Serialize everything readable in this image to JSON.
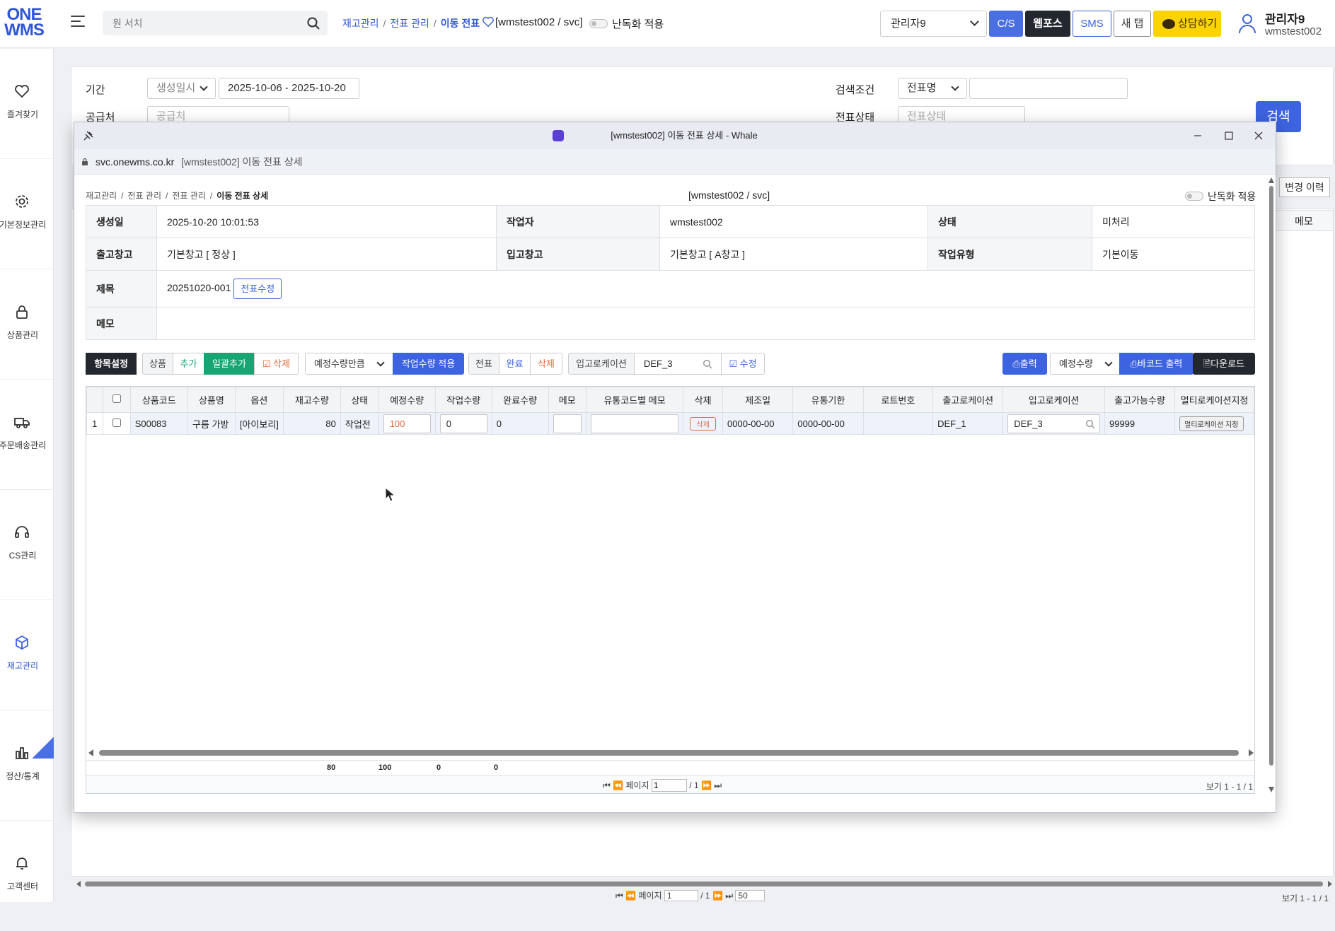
{
  "topbar": {
    "logo_line1": "ONE",
    "logo_line2": "WMS",
    "search_placeholder": "원 서치",
    "breadcrumb": [
      "재고관리",
      "전표 관리",
      "이동 전표"
    ],
    "system": "[wmstest002 / svc]",
    "obfuscate_label": "난독화 적용",
    "admin_select": "관리자9",
    "buttons": {
      "cs": "C/S",
      "webpos": "웹포스",
      "sms": "SMS",
      "newtab": "새 탭",
      "consult": "상담하기"
    },
    "user_name": "관리자9",
    "user_id": "wmstest002"
  },
  "sidebar": {
    "items": [
      {
        "label": "즐겨찾기",
        "icon": "heart-icon"
      },
      {
        "label": "기본정보관리",
        "icon": "gear-icon"
      },
      {
        "label": "상품관리",
        "icon": "lock-icon"
      },
      {
        "label": "주문배송관리",
        "icon": "truck-icon"
      },
      {
        "label": "CS관리",
        "icon": "headset-icon"
      },
      {
        "label": "재고관리",
        "icon": "box-icon"
      },
      {
        "label": "정산/통계",
        "icon": "bar-chart-icon"
      },
      {
        "label": "고객센터",
        "icon": "bell-icon"
      }
    ],
    "active_index": 5
  },
  "background": {
    "period_label": "기간",
    "period_type": "생성일시",
    "period_value": "2025-10-06 - 2025-10-20",
    "supplier_label": "공급처",
    "supplier_placeholder": "공급처",
    "search_cond_label": "검색조건",
    "search_cond_value": "전표명",
    "slip_status_label": "전표상태",
    "slip_status_placeholder": "전표상태",
    "search_button": "검색",
    "history_button": "변경 이력",
    "memo_header": "메모",
    "pager_label": "페이지",
    "page_value": "1",
    "page_total": "/ 1",
    "page_size": "50",
    "view_count": "보기 1 - 1 / 1"
  },
  "window": {
    "title": "[wmstest002] 이동 전표 상세 - Whale",
    "url_host": "svc.onewms.co.kr",
    "url_title": "[wmstest002] 이동 전표 상세"
  },
  "modal": {
    "breadcrumb": [
      "재고관리",
      "전표 관리",
      "전표 관리",
      "이동 전표 상세"
    ],
    "system": "[wmstest002 / svc]",
    "obfuscate_label": "난독화 적용",
    "info": {
      "created_label": "생성일",
      "created": "2025-10-20 10:01:53",
      "worker_label": "작업자",
      "worker": "wmstest002",
      "status_label": "상태",
      "status": "미처리",
      "out_wh_label": "출고창고",
      "out_wh": "기본창고 [ 정상 ]",
      "in_wh_label": "입고창고",
      "in_wh": "기본창고 [ A창고 ]",
      "work_type_label": "작업유형",
      "work_type": "기본이동",
      "title_label": "제목",
      "title": "20251020-001",
      "edit_slip_button": "전표수정",
      "memo_label": "메모",
      "memo": ""
    },
    "toolbar": {
      "item_settings": "항목설정",
      "product": "상품",
      "add": "추가",
      "bulk_add": "일괄추가",
      "delete": "삭제",
      "qty_mode": "예정수량만큼",
      "apply_work_qty": "작업수량 적용",
      "slip": "전표",
      "complete": "완료",
      "slip_delete": "삭제",
      "in_location_label": "입고로케이션",
      "in_location_value": "DEF_3",
      "modify": "수정",
      "print": "출력",
      "qty_select": "예정수량",
      "barcode_print": "바코드 출력",
      "download": "다운로드"
    },
    "grid": {
      "headers": [
        "상품코드",
        "상품명",
        "옵션",
        "재고수량",
        "상태",
        "예정수량",
        "작업수량",
        "완료수량",
        "메모",
        "유통코드별 메모",
        "삭제",
        "제조일",
        "유통기한",
        "로트번호",
        "출고로케이션",
        "입고로케이션",
        "출고가능수량",
        "멀티로케이션지정"
      ],
      "rows": [
        {
          "no": "1",
          "code": "S00083",
          "name": "구름 가방",
          "option": "[아이보리]",
          "stock": "80",
          "state": "작업전",
          "planned": "100",
          "work": "0",
          "done": "0",
          "memo": "",
          "dist_memo": "",
          "delete": "삭제",
          "mfg": "0000-00-00",
          "exp": "0000-00-00",
          "lot": "",
          "out_loc": "DEF_1",
          "in_loc": "DEF_3",
          "available": "99999",
          "multi": "멀티로케이션 지정"
        }
      ],
      "totals": {
        "stock": "80",
        "planned": "100",
        "work": "0",
        "done": "0"
      },
      "pager_label": "페이지",
      "page_value": "1",
      "page_total": "/ 1",
      "view_count": "보기 1 - 1 / 1"
    }
  },
  "colors": {
    "accent": "#3d63e0",
    "green": "#17a673",
    "dark": "#23272e",
    "orange": "#e06a3a",
    "yellow": "#fbd300"
  }
}
